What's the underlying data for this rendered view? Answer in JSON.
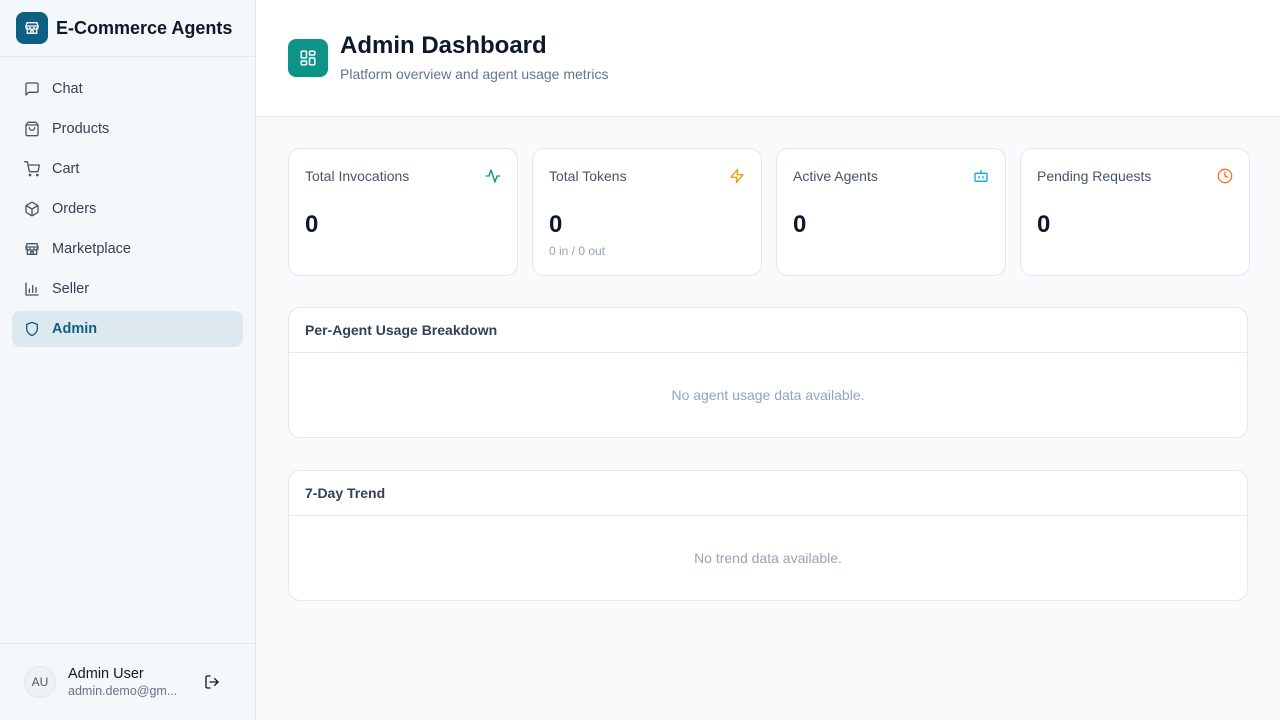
{
  "app": {
    "title": "E-Commerce Agents",
    "logo_icon": "store-icon",
    "brand_color": "#0f5e84"
  },
  "nav": {
    "items": [
      {
        "label": "Chat",
        "icon": "chat-icon",
        "active": false
      },
      {
        "label": "Products",
        "icon": "shopping-bag-icon",
        "active": false
      },
      {
        "label": "Cart",
        "icon": "cart-icon",
        "active": false
      },
      {
        "label": "Orders",
        "icon": "package-icon",
        "active": false
      },
      {
        "label": "Marketplace",
        "icon": "store-icon",
        "active": false
      },
      {
        "label": "Seller",
        "icon": "bar-chart-icon",
        "active": false
      },
      {
        "label": "Admin",
        "icon": "shield-icon",
        "active": true
      }
    ]
  },
  "user": {
    "initials": "AU",
    "name": "Admin User",
    "email": "admin.demo@gm..."
  },
  "header": {
    "title": "Admin Dashboard",
    "subtitle": "Platform overview and agent usage metrics",
    "icon": "dashboard-grid-icon",
    "accent": "#0d9488"
  },
  "stats": [
    {
      "label": "Total Invocations",
      "value": "0",
      "sub": "",
      "icon": "activity-icon",
      "color": "#0d9488"
    },
    {
      "label": "Total Tokens",
      "value": "0",
      "sub": "0 in / 0 out",
      "icon": "zap-icon",
      "color": "#f59e0b"
    },
    {
      "label": "Active Agents",
      "value": "0",
      "sub": "",
      "icon": "bot-icon",
      "color": "#0ea5e9"
    },
    {
      "label": "Pending Requests",
      "value": "0",
      "sub": "",
      "icon": "clock-icon",
      "color": "#f97316"
    }
  ],
  "usage_panel": {
    "title": "Per-Agent Usage Breakdown",
    "empty": "No agent usage data available."
  },
  "trend_panel": {
    "title": "7-Day Trend",
    "empty": "No trend data available."
  }
}
